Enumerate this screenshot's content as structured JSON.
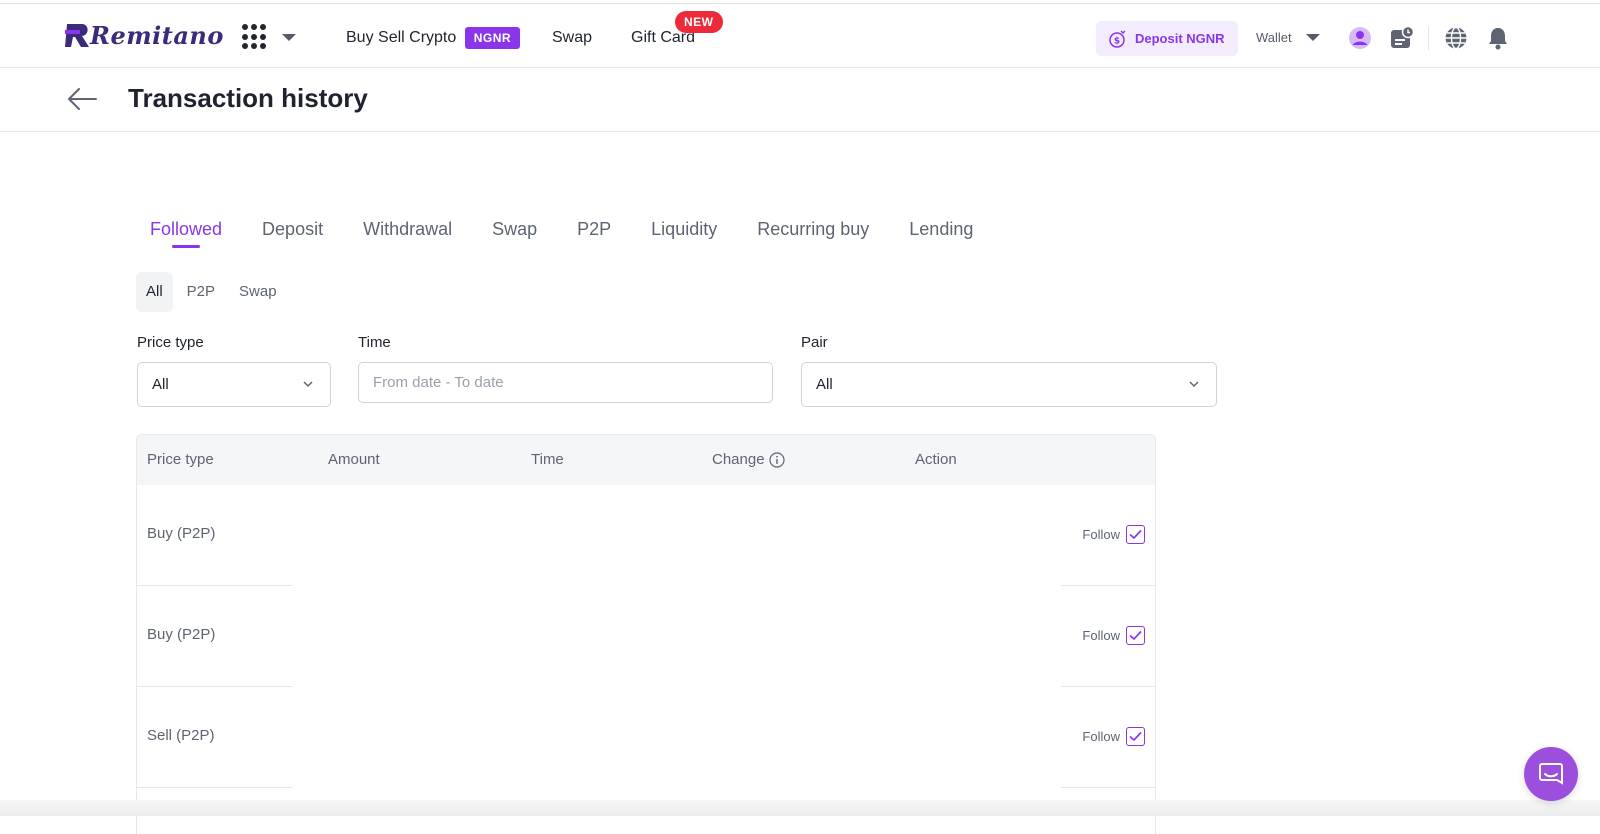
{
  "brand": {
    "name": "Remitano",
    "color": "#3d2a7a",
    "accent": "#8a36e8"
  },
  "nav": {
    "apps_icon": "grid-icon",
    "buy_sell": "Buy Sell Crypto",
    "buy_sell_badge": "NGNR",
    "swap": "Swap",
    "gift_card": "Gift Card",
    "gift_card_badge": "NEW"
  },
  "header_actions": {
    "deposit_label": "Deposit NGNR",
    "wallet_label": "Wallet"
  },
  "page": {
    "title": "Transaction history"
  },
  "tabs": [
    {
      "label": "Followed",
      "active": true
    },
    {
      "label": "Deposit"
    },
    {
      "label": "Withdrawal"
    },
    {
      "label": "Swap"
    },
    {
      "label": "P2P"
    },
    {
      "label": "Liquidity"
    },
    {
      "label": "Recurring buy"
    },
    {
      "label": "Lending"
    }
  ],
  "subtabs": [
    {
      "label": "All",
      "active": true
    },
    {
      "label": "P2P"
    },
    {
      "label": "Swap"
    }
  ],
  "filters": {
    "price_type": {
      "label": "Price type",
      "value": "All"
    },
    "time": {
      "label": "Time",
      "placeholder": "From date - To date"
    },
    "pair": {
      "label": "Pair",
      "value": "All"
    }
  },
  "table": {
    "columns": [
      "Price type",
      "Amount",
      "Time",
      "Change",
      "Action"
    ],
    "rows": [
      {
        "price_type": "Buy (P2P)",
        "action": "Follow",
        "checked": true
      },
      {
        "price_type": "Buy (P2P)",
        "action": "Follow",
        "checked": true
      },
      {
        "price_type": "Sell (P2P)",
        "action": "Follow",
        "checked": true
      }
    ]
  }
}
